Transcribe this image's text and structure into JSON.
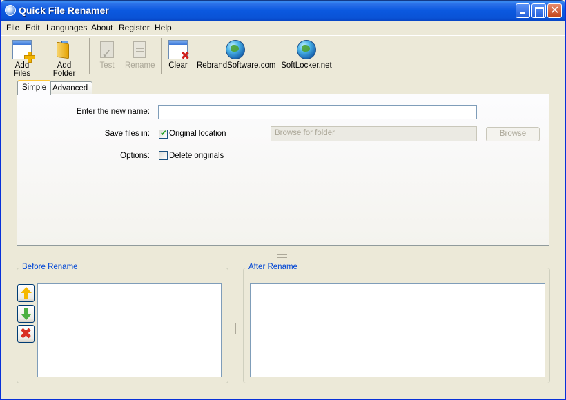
{
  "window": {
    "title": "Quick File Renamer"
  },
  "menu": {
    "items": [
      "File",
      "Edit",
      "Languages",
      "About",
      "Register",
      "Help"
    ]
  },
  "toolbar": {
    "add_files": "Add Files",
    "add_folder": "Add Folder",
    "test": "Test",
    "rename": "Rename",
    "clear": "Clear",
    "rebrand": "RebrandSoftware.com",
    "softlocker": "SoftLocker.net"
  },
  "tabs": {
    "simple": "Simple",
    "advanced": "Advanced"
  },
  "form": {
    "new_name_label": "Enter the new name:",
    "new_name_value": "",
    "save_in_label": "Save files in:",
    "original_location": "Original location",
    "original_location_checked": true,
    "browse_placeholder": "Browse for folder",
    "browse_button": "Browse",
    "options_label": "Options:",
    "delete_originals": "Delete originals",
    "delete_originals_checked": false
  },
  "panels": {
    "before_title": "Before Rename",
    "after_title": "After Rename"
  },
  "icons": {
    "app": "app-globe-icon",
    "move_up": "arrow-up-icon",
    "move_down": "arrow-down-icon",
    "remove": "remove-x-icon"
  }
}
